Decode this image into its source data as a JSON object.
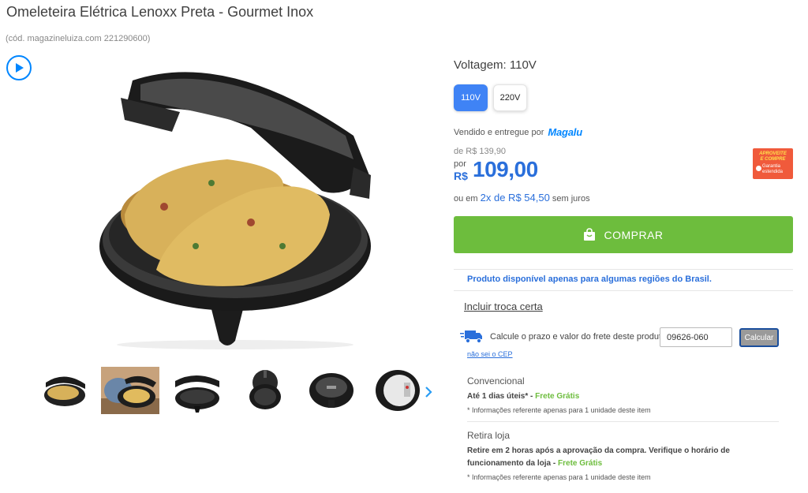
{
  "product": {
    "title": "Omeleteira Elétrica Lenoxx Preta - Gourmet Inox",
    "code": "(cód. magazineluiza.com 221290600)"
  },
  "icons": {
    "play": "play-icon",
    "gallery_next": "chevron-right-icon",
    "buy": "shopping-bag-icon",
    "shipping": "truck-icon"
  },
  "voltage": {
    "label": "Voltagem: 110V",
    "options": [
      {
        "label": "110V",
        "selected": true
      },
      {
        "label": "220V",
        "selected": false
      }
    ]
  },
  "seller": {
    "prefix": "Vendido e entregue por",
    "brand": "Magalu"
  },
  "price": {
    "old": "de R$ 139,90",
    "por": "por",
    "currency": "R$",
    "value": "109,00",
    "installment_prefix": "ou em",
    "installment_value": "2x de R$ 54,50",
    "installment_suffix": "sem juros"
  },
  "badge": {
    "line1": "APROVEITE",
    "line2": "E COMPRE",
    "line3": "Garantia",
    "line4": "estendida"
  },
  "buy_label": "COMPRAR",
  "availability": "Produto disponível apenas para algumas regiões do Brasil.",
  "troca_certa": "Incluir troca certa",
  "shipping": {
    "label": "Calcule o prazo e valor do frete deste produto:",
    "cep_value": "09626-060",
    "calc_label": "Calcular",
    "no_cep": "não sei o CEP",
    "options": [
      {
        "title": "Convencional",
        "line": "Até 1 dias úteis* - ",
        "free": "Frete Grátis",
        "note": "* Informações referente apenas para 1 unidade deste item"
      },
      {
        "title": "Retira loja",
        "line": "Retire em 2 horas após a aprovação da compra. Verifique o horário de funcionamento da loja - ",
        "free": "Frete Grátis",
        "note": "* Informações referente apenas para 1 unidade deste item"
      }
    ]
  },
  "colors": {
    "accent_blue": "#2a6fdb",
    "buy_green": "#6dbd3d",
    "selected_voltage": "#3f83f5",
    "badge_red": "#f05a3b"
  }
}
